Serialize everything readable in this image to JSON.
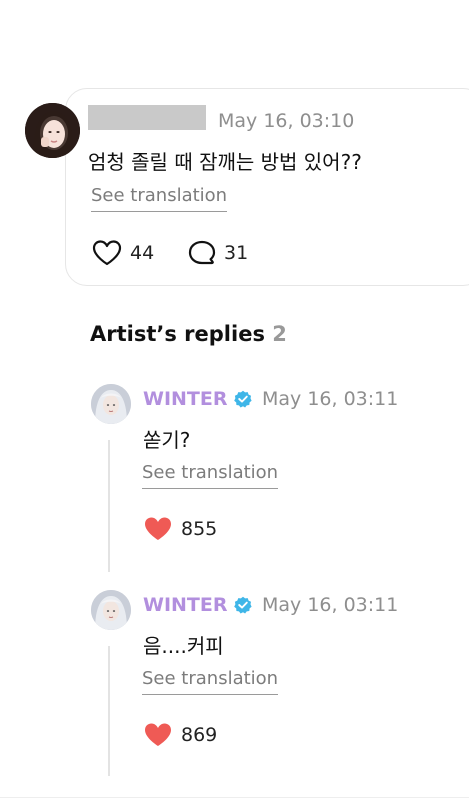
{
  "post": {
    "time": "May 16, 03:10",
    "text": "엄청 졸릴 때 잠깨는 방법 있어??",
    "see_translation": "See translation",
    "likes": "44",
    "comments": "31"
  },
  "replies_section": {
    "title": "Artist’s replies",
    "count": "2"
  },
  "replies": [
    {
      "name": "WINTER",
      "time": "May 16, 03:11",
      "text": "쏟기?",
      "see_translation": "See translation",
      "likes": "855"
    },
    {
      "name": "WINTER",
      "time": "May 16, 03:11",
      "text": "음....커피",
      "see_translation": "See translation",
      "likes": "869"
    }
  ],
  "colors": {
    "artist_name": "#b28fde",
    "verified_badge": "#3fb6e8",
    "heart_filled": "#ef5a55",
    "muted_text": "#8e8e8e"
  }
}
